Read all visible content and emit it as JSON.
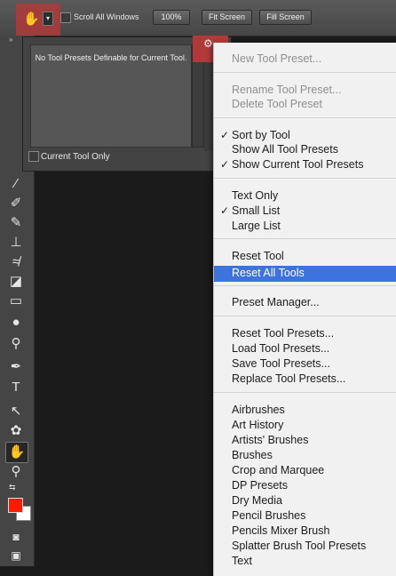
{
  "options_bar": {
    "scroll_all_windows_label": "Scroll All Windows",
    "zoom_100_label": "100%",
    "fit_screen_label": "Fit Screen",
    "fill_screen_label": "Fill Screen"
  },
  "presets_panel": {
    "empty_message": "No Tool Presets Definable for Current Tool.",
    "current_tool_only_label": "Current Tool Only"
  },
  "menu": {
    "new_tool_preset": "New Tool Preset...",
    "rename_tool_preset": "Rename Tool Preset...",
    "delete_tool_preset": "Delete Tool Preset",
    "sort_by_tool": "Sort by Tool",
    "show_all_tool_presets": "Show All Tool Presets",
    "show_current_tool_presets": "Show Current Tool Presets",
    "text_only": "Text Only",
    "small_list": "Small List",
    "large_list": "Large List",
    "reset_tool": "Reset Tool",
    "reset_all_tools": "Reset All Tools",
    "preset_manager": "Preset Manager...",
    "reset_tool_presets": "Reset Tool Presets...",
    "load_tool_presets": "Load Tool Presets...",
    "save_tool_presets": "Save Tool Presets...",
    "replace_tool_presets": "Replace Tool Presets...",
    "libraries": [
      "Airbrushes",
      "Art History",
      "Artists' Brushes",
      "Brushes",
      "Crop and Marquee",
      "DP Presets",
      "Dry Media",
      "Pencil Brushes",
      "Pencils Mixer Brush",
      "Splatter Brush Tool Presets",
      "Text"
    ]
  },
  "colors": {
    "foreground": "#ff1a00",
    "background": "#ffffff",
    "highlight": "#3c73dc",
    "hand_highlight": "#b03a3a"
  }
}
